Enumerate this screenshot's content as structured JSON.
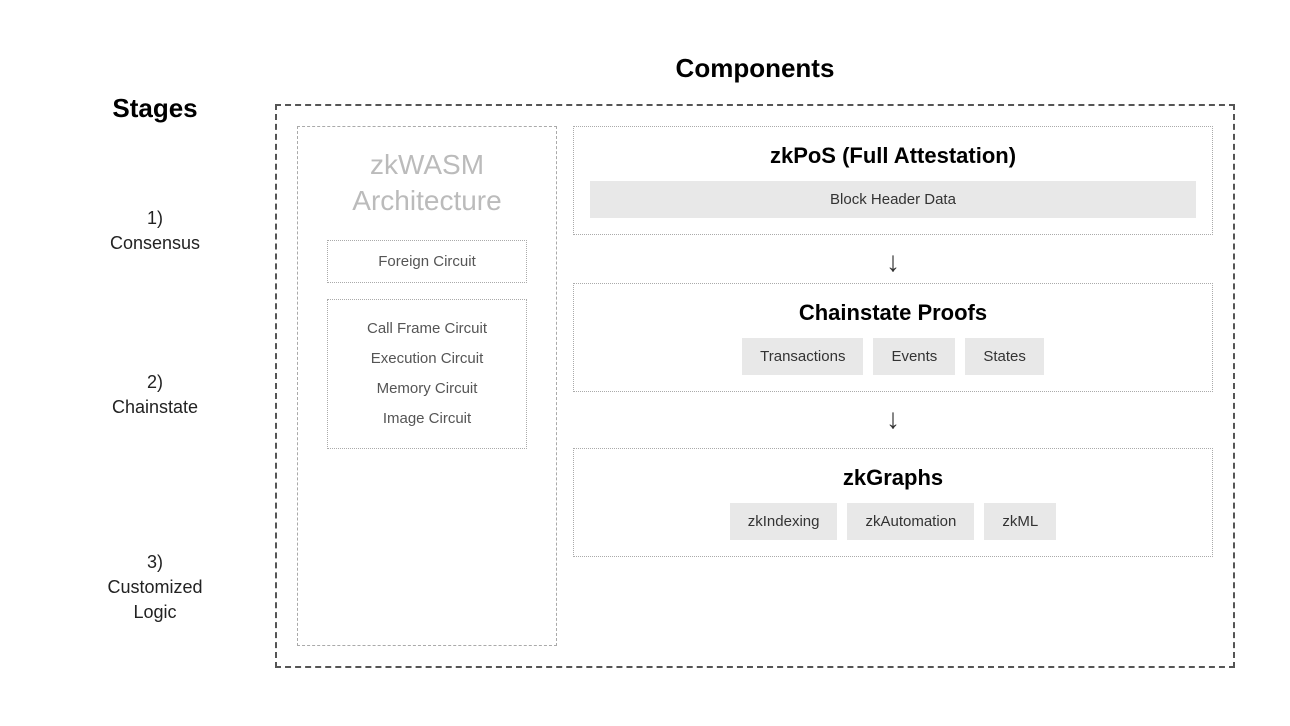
{
  "header": {
    "stages_title": "Stages",
    "components_title": "Components"
  },
  "stages": [
    {
      "id": "consensus",
      "label": "1)\nConsensus"
    },
    {
      "id": "chainstate",
      "label": "2)\nChainstate"
    },
    {
      "id": "customized",
      "label": "3)\nCustomized\nLogic"
    }
  ],
  "zkwasm": {
    "title": "zkWASM\nArchitecture",
    "circuit1": "Foreign Circuit",
    "circuit2_lines": [
      "Call Frame Circuit",
      "Execution Circuit",
      "Memory Circuit",
      "Image Circuit"
    ]
  },
  "zkpos": {
    "title": "zkPoS (Full Attestation)",
    "subtitle": "Block Header Data"
  },
  "chainstate": {
    "title": "Chainstate Proofs",
    "items": [
      "Transactions",
      "Events",
      "States"
    ]
  },
  "zkgraphs": {
    "title": "zkGraphs",
    "items": [
      "zkIndexing",
      "zkAutomation",
      "zkML"
    ]
  }
}
